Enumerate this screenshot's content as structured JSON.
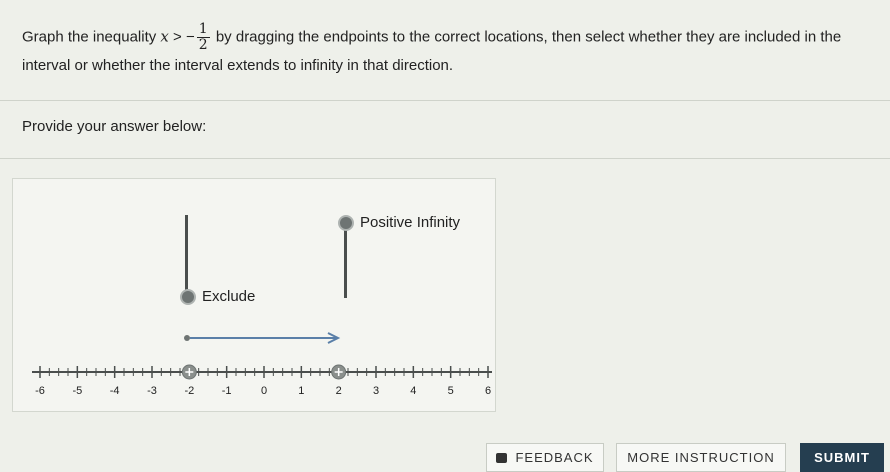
{
  "prompt": {
    "before": "Graph the inequality ",
    "variable": "x",
    "operator": " > −",
    "frac_num": "1",
    "frac_den": "2",
    "after": " by dragging the endpoints to the correct locations, then select whether they are included in the interval or whether the interval extends to infinity in that direction."
  },
  "provide_label": "Provide your answer below:",
  "tools": {
    "positive_infinity": "Positive Infinity",
    "exclude": "Exclude"
  },
  "number_line": {
    "min": -6,
    "max": 6,
    "tick_labels": [
      "-6",
      "-5",
      "-4",
      "-3",
      "-2",
      "-1",
      "0",
      "1",
      "2",
      "3",
      "4",
      "5",
      "6"
    ],
    "handle_positions": [
      -2,
      2
    ],
    "colors": {
      "line": "#4a4e4d",
      "handle": "#8a8f8c"
    }
  },
  "buttons": {
    "feedback": "FEEDBACK",
    "more_instruction": "MORE INSTRUCTION",
    "submit": "SUBMIT"
  }
}
